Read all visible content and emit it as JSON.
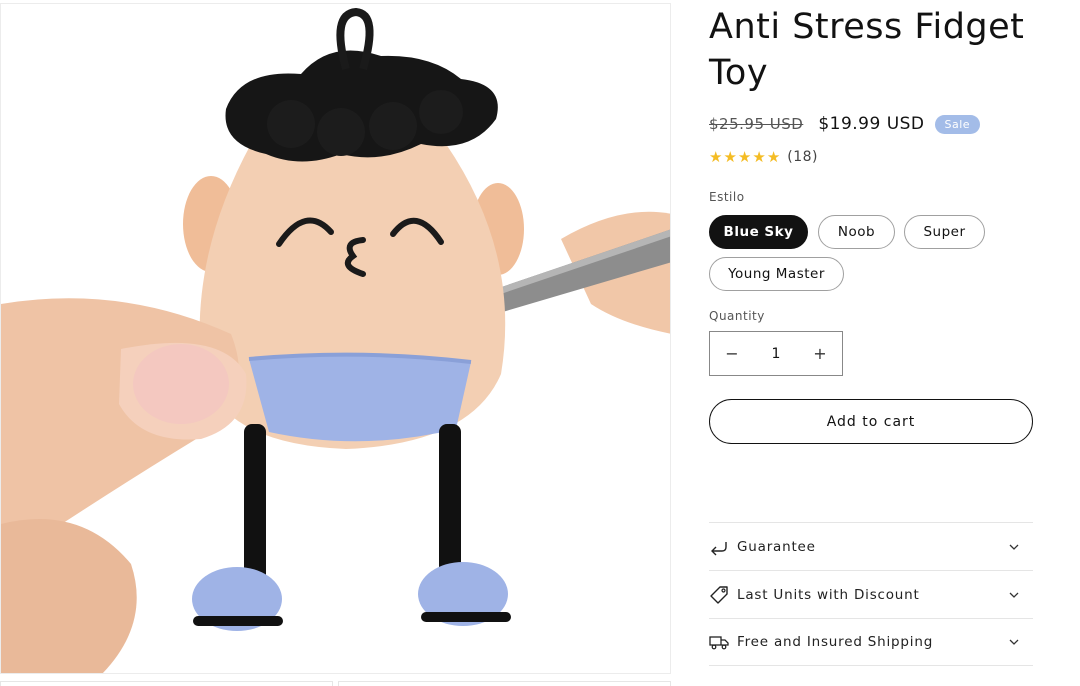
{
  "product": {
    "title": "Anti Stress Fidget Toy",
    "price_old": "$25.95 USD",
    "price_new": "$19.99 USD",
    "badge": "Sale",
    "rating_count": "(18)",
    "stars": 5,
    "image_alt": "fidget-toy-product-photo"
  },
  "variant": {
    "label": "Estilo",
    "options": [
      "Blue Sky",
      "Noob",
      "Super",
      "Young Master"
    ],
    "selected": "Blue Sky"
  },
  "quantity": {
    "label": "Quantity",
    "value": "1",
    "minus": "−",
    "plus": "+"
  },
  "cart": {
    "label": "Add to cart"
  },
  "accordion": [
    {
      "label": "Guarantee",
      "icon": "return-arrow-icon"
    },
    {
      "label": "Last Units with Discount",
      "icon": "price-tag-icon"
    },
    {
      "label": "Free and Insured Shipping",
      "icon": "truck-icon"
    }
  ],
  "colors": {
    "accent_badge": "#a3bce8",
    "star": "#f4bc24",
    "selected_pill": "#121212"
  }
}
